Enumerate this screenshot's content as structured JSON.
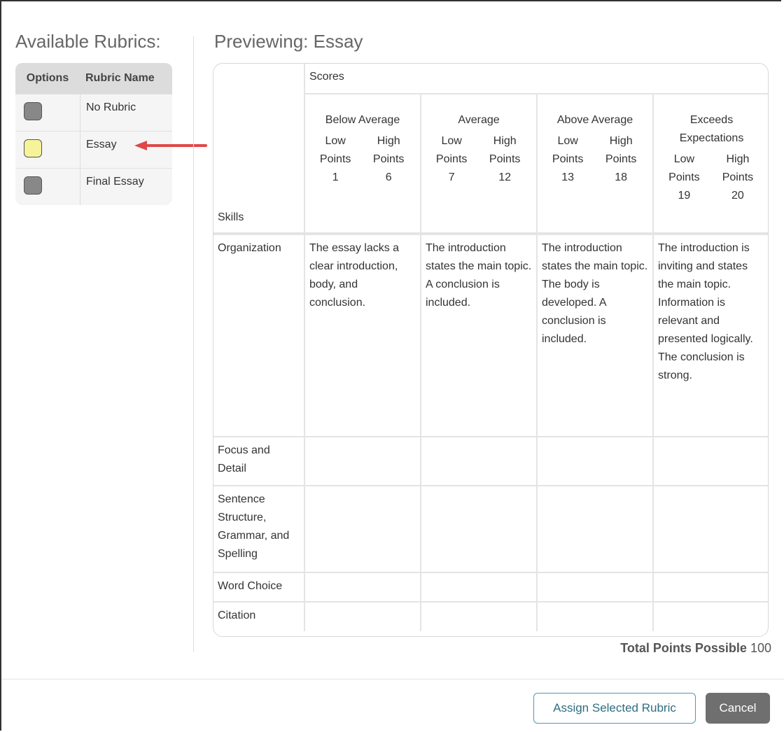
{
  "left": {
    "title": "Available Rubrics:",
    "columns": {
      "options": "Options",
      "name": "Rubric Name"
    },
    "rubrics": [
      {
        "name": "No Rubric",
        "color": "#888888"
      },
      {
        "name": "Essay",
        "color": "#f7f39a"
      },
      {
        "name": "Final Essay",
        "color": "#888888"
      }
    ]
  },
  "preview": {
    "title": "Previewing: Essay",
    "scores_label": "Scores",
    "skills_label": "Skills",
    "levels": [
      {
        "name": "Below Average",
        "low_label": "Low Points",
        "high_label": "High Points",
        "low": "1",
        "high": "6"
      },
      {
        "name": "Average",
        "low_label": "Low Points",
        "high_label": "High Points",
        "low": "7",
        "high": "12"
      },
      {
        "name": "Above Average",
        "low_label": "Low Points",
        "high_label": "High Points",
        "low": "13",
        "high": "18"
      },
      {
        "name": "Exceeds Expectations",
        "low_label": "Low Points",
        "high_label": "High Points",
        "low": "19",
        "high": "20"
      }
    ],
    "skills": [
      {
        "name": "Organization",
        "descriptions": [
          "The essay lacks a clear introduction, body, and conclusion.",
          "The introduction states the main topic. A conclusion is included.",
          "The introduction states the main topic. The body is developed. A conclusion is included.",
          "The introduction is inviting and states the main topic. Information is relevant and presented logically. The conclusion is strong."
        ]
      },
      {
        "name": "Focus and Detail",
        "descriptions": [
          "",
          "",
          "",
          ""
        ]
      },
      {
        "name": "Sentence Structure, Grammar, and Spelling",
        "descriptions": [
          "",
          "",
          "",
          ""
        ]
      },
      {
        "name": "Word Choice",
        "descriptions": [
          "",
          "",
          "",
          ""
        ]
      },
      {
        "name": "Citation",
        "descriptions": [
          "",
          "",
          "",
          ""
        ]
      }
    ],
    "total_label": "Total Points Possible",
    "total_value": "100"
  },
  "buttons": {
    "assign": "Assign Selected Rubric",
    "cancel": "Cancel"
  },
  "colors": {
    "accent": "#4a9bb0",
    "arrow": "#e04848",
    "cancel_bg": "#6f6f6f"
  }
}
